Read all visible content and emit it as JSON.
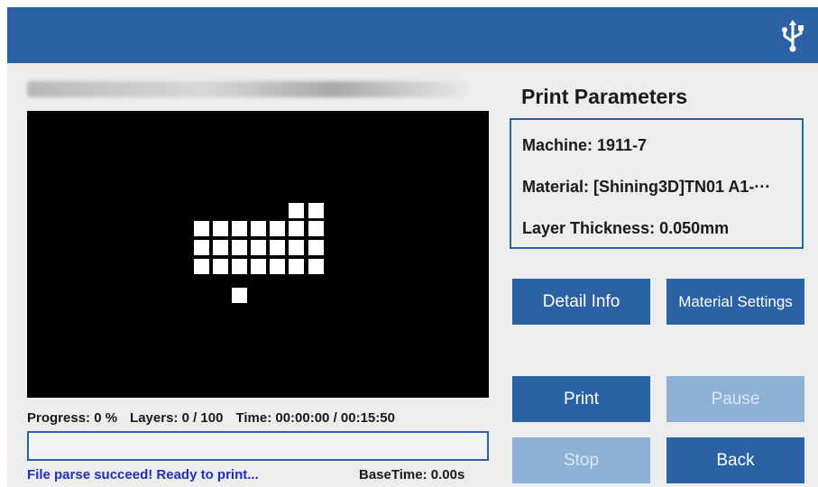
{
  "window": {
    "title_strip": "",
    "accent": "#2b62a5"
  },
  "header": {
    "usb_icon": "usb-icon"
  },
  "preview": {
    "filename": ""
  },
  "progress": {
    "progress_text": "Progress: 0 %",
    "layers_text": "Layers: 0 / 100",
    "time_text": "Time: 00:00:00 / 00:15:50",
    "fraction": 0
  },
  "status": {
    "message": "File parse succeed! Ready to print...",
    "base_time": "BaseTime: 0.00s",
    "message_color": "#1f2fbf"
  },
  "params": {
    "title": "Print Parameters",
    "machine": "Machine: 1911-7",
    "material": "Material: [Shining3D]TN01 A1-···",
    "layer_thickness": "Layer Thickness: 0.050mm"
  },
  "buttons": {
    "detail_info": "Detail Info",
    "material_settings": "Material Settings",
    "print": "Print",
    "pause": "Pause",
    "stop": "Stop",
    "back": "Back"
  }
}
